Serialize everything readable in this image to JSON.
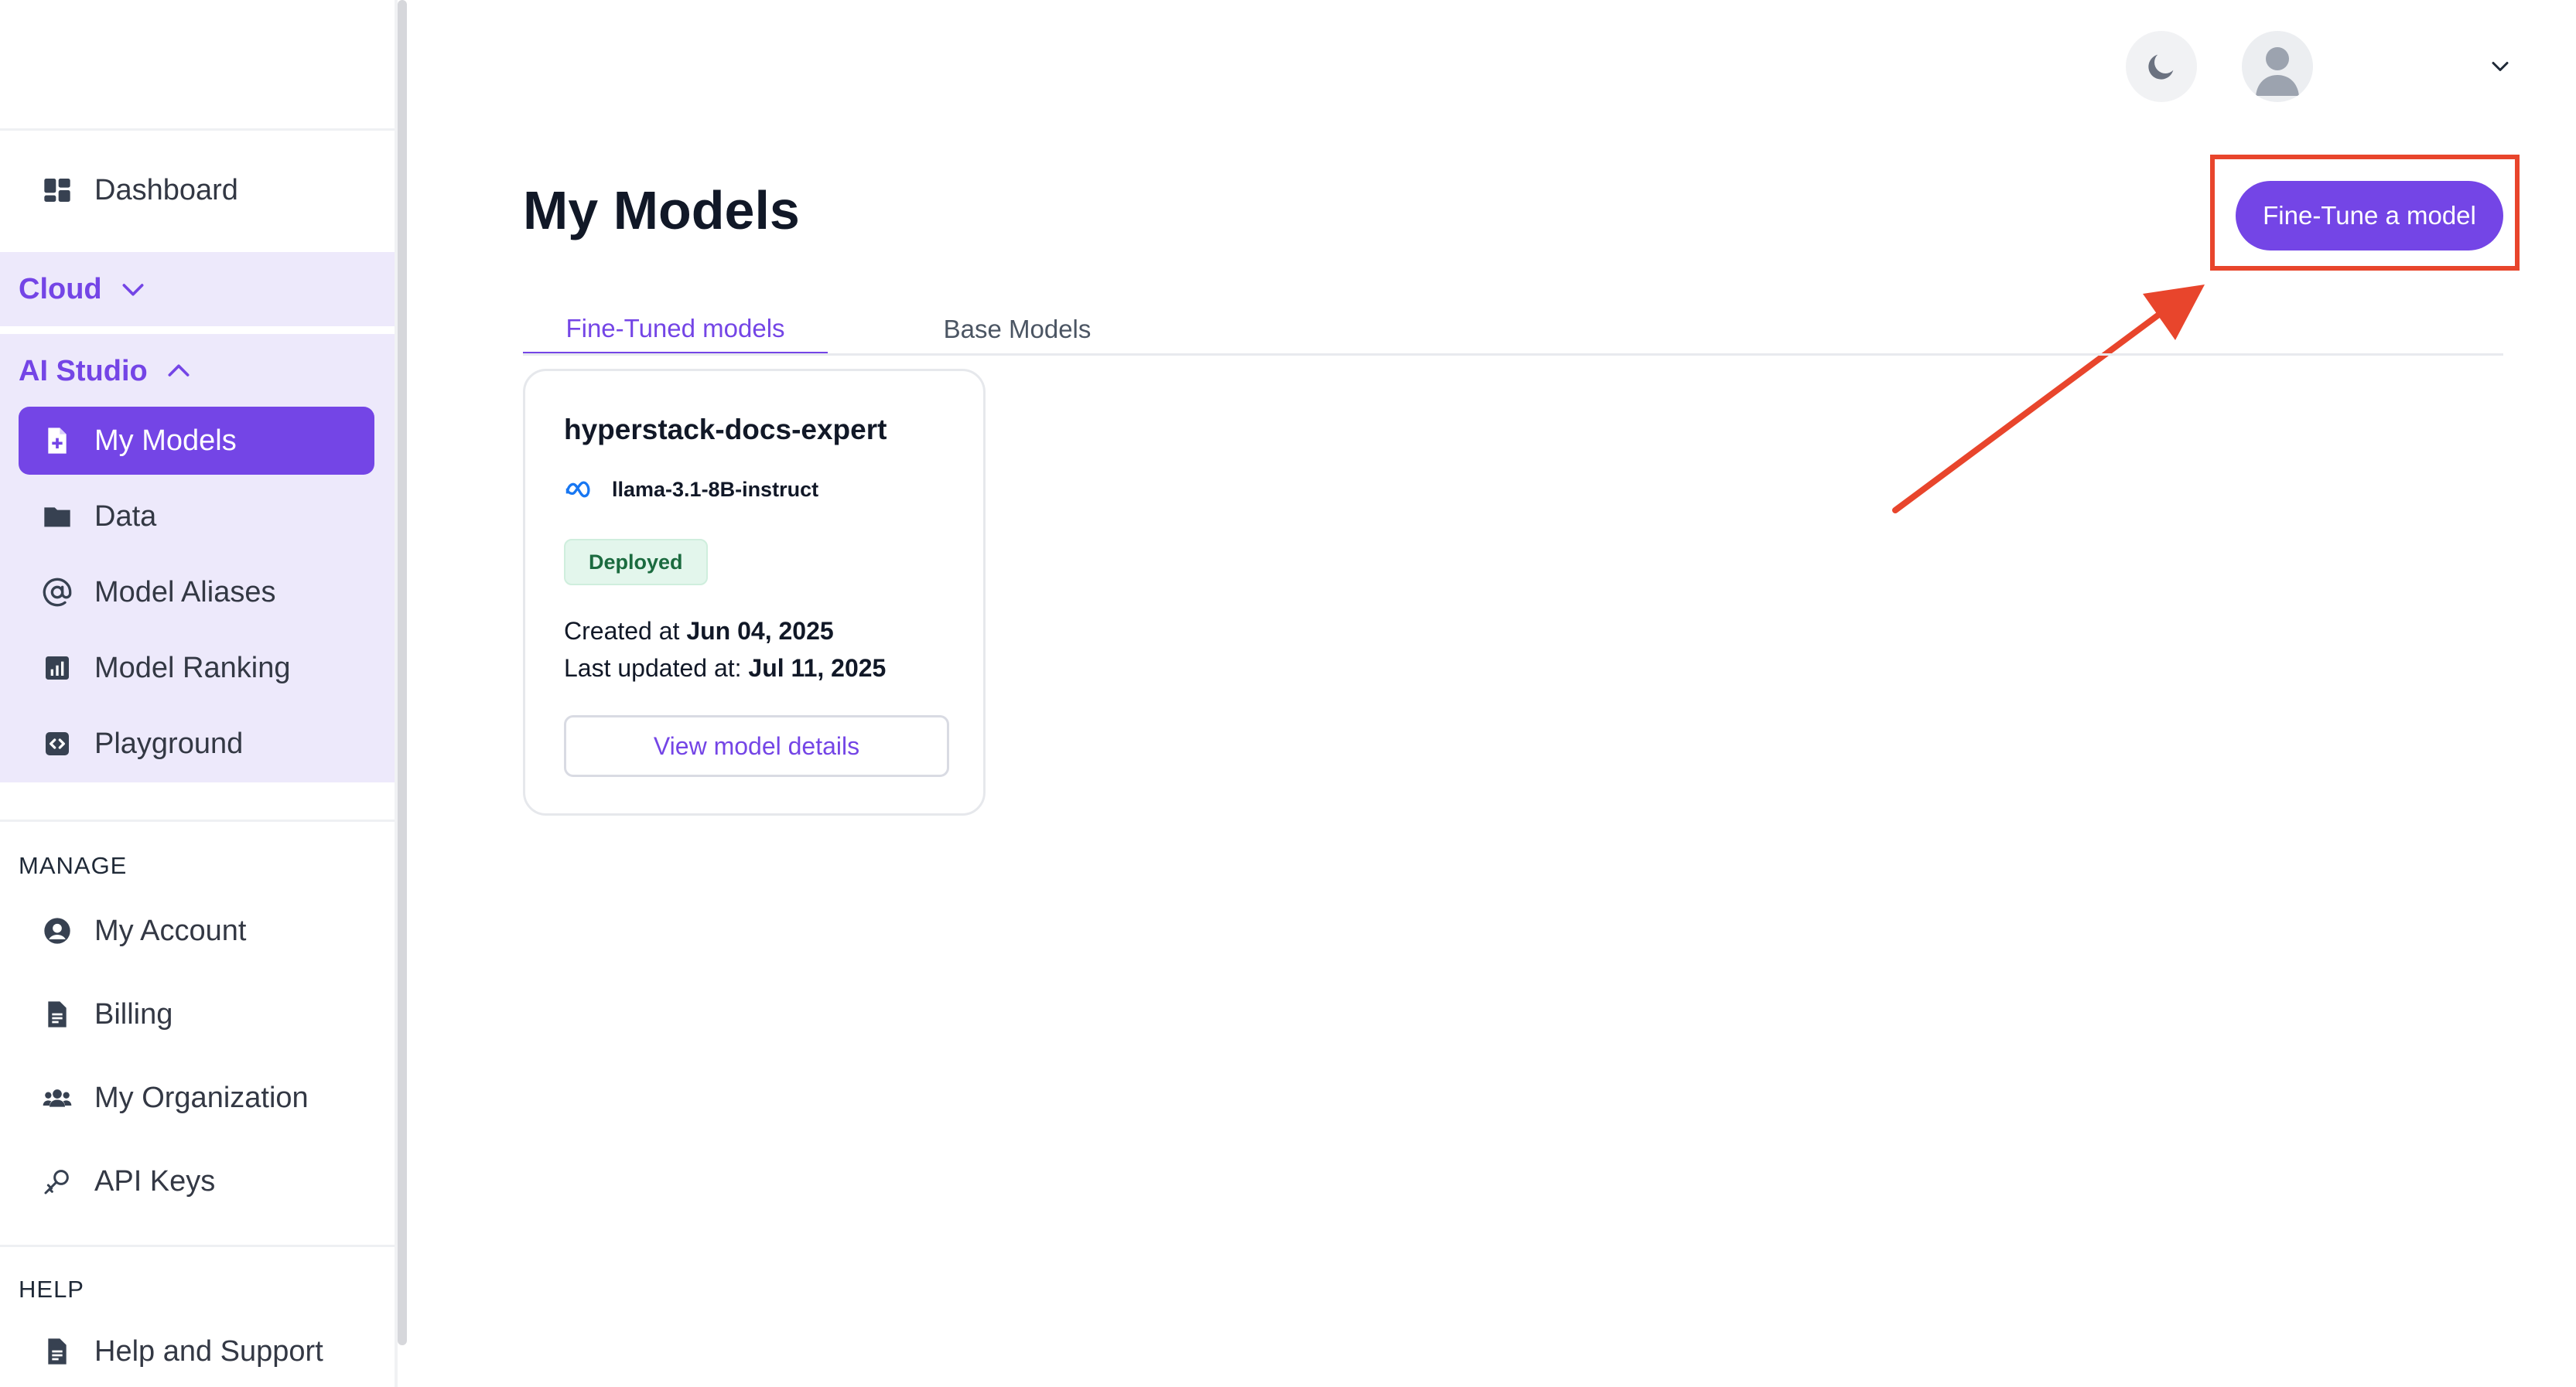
{
  "sidebar": {
    "dashboard": "Dashboard",
    "cloud": "Cloud",
    "ai_studio": "AI Studio",
    "ai_items": [
      "My Models",
      "Data",
      "Model Aliases",
      "Model Ranking",
      "Playground"
    ],
    "manage_label": "MANAGE",
    "manage_items": [
      "My Account",
      "Billing",
      "My Organization",
      "API Keys"
    ],
    "help_label": "HELP",
    "help_items": [
      "Help and Support"
    ]
  },
  "header": {
    "theme_icon": "moon-icon",
    "avatar_icon": "user-avatar-icon"
  },
  "main": {
    "title": "My Models",
    "fine_tune_button": "Fine-Tune a model",
    "tabs": [
      "Fine-Tuned models",
      "Base Models"
    ],
    "active_tab": "Fine-Tuned models"
  },
  "card": {
    "name": "hyperstack-docs-expert",
    "base_model": "llama-3.1-8B-instruct",
    "status": "Deployed",
    "created_label": "Created at",
    "created_value": "Jun 04, 2025",
    "updated_label": "Last updated at:",
    "updated_value": "Jul 11, 2025",
    "view_button": "View model details"
  },
  "colors": {
    "accent": "#7445e6",
    "annotation": "#e8452c",
    "deployed_bg": "#e3f6ec"
  }
}
